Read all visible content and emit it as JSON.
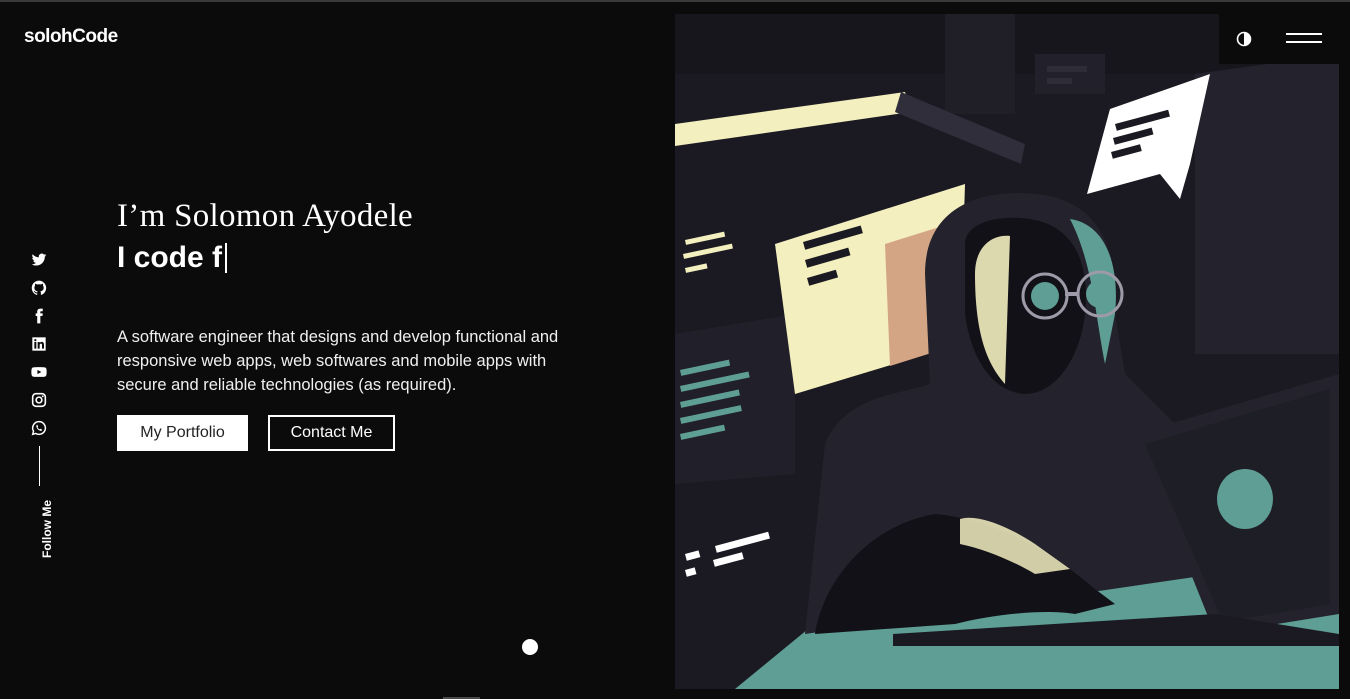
{
  "brand": {
    "logo_text": "solohCode"
  },
  "header": {
    "theme_toggle_icon": "contrast-icon",
    "menu_icon": "hamburger-menu-icon"
  },
  "social": {
    "items": [
      {
        "icon": "twitter-icon"
      },
      {
        "icon": "github-icon"
      },
      {
        "icon": "facebook-icon"
      },
      {
        "icon": "linkedin-icon"
      },
      {
        "icon": "youtube-icon"
      },
      {
        "icon": "instagram-icon"
      },
      {
        "icon": "whatsapp-icon"
      }
    ],
    "follow_label": "Follow Me"
  },
  "hero": {
    "name": "I’m Solomon Ayodele",
    "typed_text": "I code f",
    "description": "A software engineer that designs and develop functional and responsive web apps, web softwares and mobile apps with secure and reliable technologies (as required).",
    "primary_button": "My Portfolio",
    "secondary_button": "Contact Me"
  },
  "colors": {
    "background": "#0b0b0b",
    "illustration_dark": "#1b1a22",
    "accent_teal": "#5e9e94",
    "accent_cream": "#f3efbf",
    "accent_peach": "#d4a585"
  }
}
